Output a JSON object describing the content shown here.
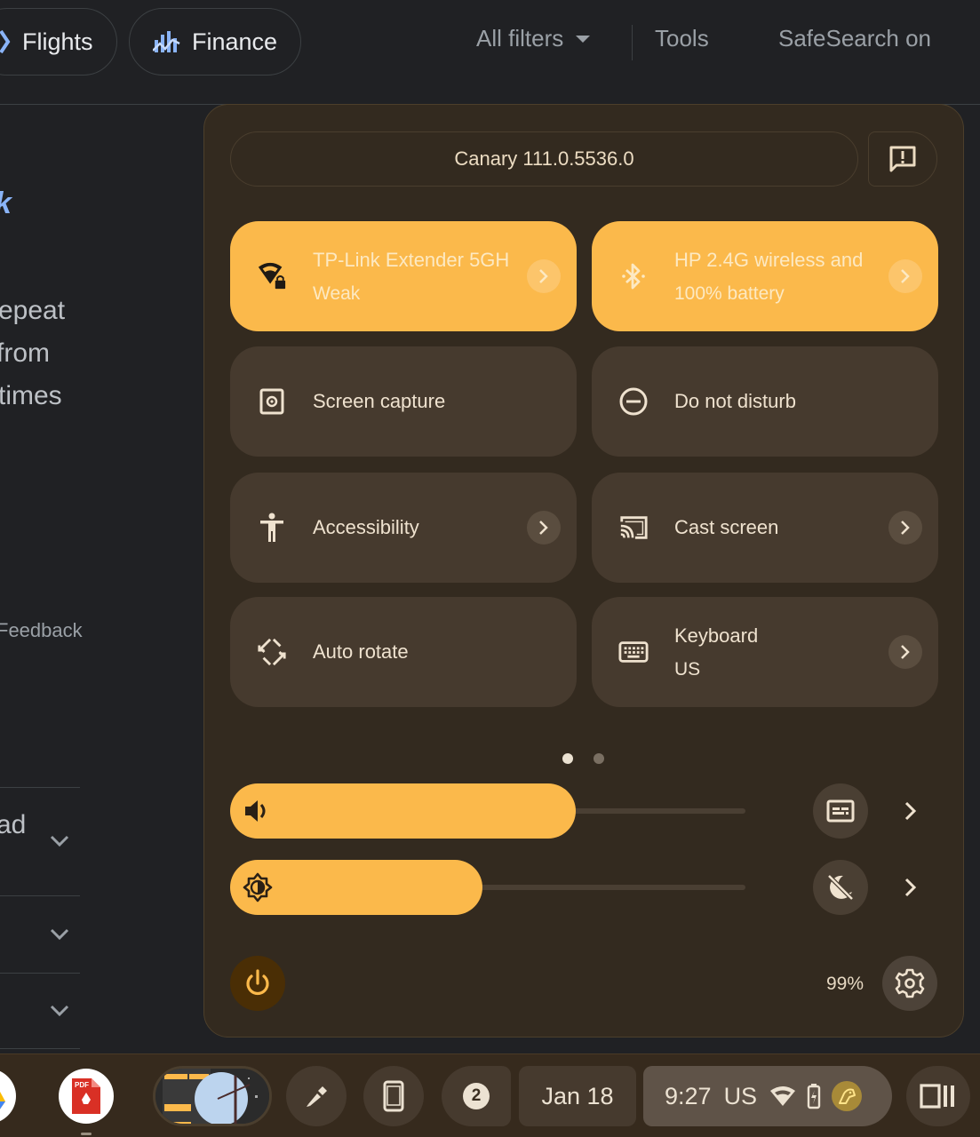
{
  "search_header": {
    "chips": [
      {
        "label": "Flights",
        "icon": "airplane-icon"
      },
      {
        "label": "Finance",
        "icon": "finance-chart-icon"
      }
    ],
    "all_filters": "All filters",
    "tools": "Tools",
    "safesearch": "SafeSearch on"
  },
  "background_page": {
    "link_fragment": "k",
    "text_lines": [
      "epeat",
      "from",
      "times"
    ],
    "feedback": "Feedback",
    "accordion_fragment": "ad"
  },
  "quick_settings": {
    "version": "Canary 111.0.5536.0",
    "feedback_icon": "feedback-icon",
    "tiles": [
      {
        "label": "TP-Link Extender 5GH",
        "sublabel": "Weak",
        "icon": "wifi-locked-icon",
        "active": true,
        "has_detail": true
      },
      {
        "label": "HP 2.4G wireless and",
        "sublabel": "100% battery",
        "icon": "bluetooth-icon",
        "active": true,
        "has_detail": true
      },
      {
        "label": "Screen capture",
        "icon": "screen-capture-icon",
        "active": false,
        "has_detail": false
      },
      {
        "label": "Do not disturb",
        "icon": "do-not-disturb-icon",
        "active": false,
        "has_detail": false
      },
      {
        "label": "Accessibility",
        "icon": "accessibility-icon",
        "active": false,
        "has_detail": true
      },
      {
        "label": "Cast screen",
        "icon": "cast-icon",
        "active": false,
        "has_detail": true
      },
      {
        "label": "Auto rotate",
        "icon": "auto-rotate-icon",
        "active": false,
        "has_detail": false
      },
      {
        "label": "Keyboard",
        "sublabel": "US",
        "icon": "keyboard-icon",
        "active": false,
        "has_detail": true
      }
    ],
    "page_indicator": {
      "current": 1,
      "total": 2
    },
    "volume": {
      "level_percent": 67,
      "icon": "volume-icon",
      "side_button_icon": "live-caption-icon"
    },
    "brightness": {
      "level_percent": 49,
      "icon": "brightness-icon",
      "side_button_icon": "night-light-off-icon"
    },
    "battery": "99%",
    "accent_color": "#fbb94b"
  },
  "shelf": {
    "apps": [
      {
        "name": "Google Drive",
        "icon": "drive-icon"
      },
      {
        "name": "PDF",
        "icon": "pdf-icon"
      }
    ],
    "notification_count": "2",
    "date": "Jan 18",
    "time": "9:27",
    "input_method": "US"
  }
}
